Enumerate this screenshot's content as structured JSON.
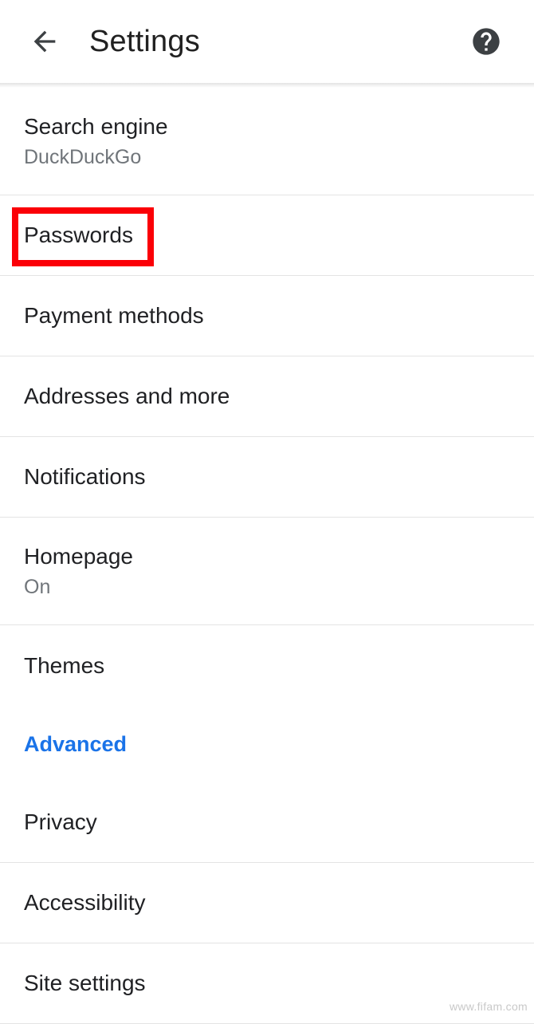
{
  "appbar": {
    "back_icon": "arrow-left-icon",
    "title": "Settings",
    "help_icon": "help-circle-icon"
  },
  "settings": {
    "rows": [
      {
        "title": "Search engine",
        "subtitle": "DuckDuckGo",
        "type": "item"
      },
      {
        "title": "Passwords",
        "subtitle": "",
        "type": "item",
        "highlighted": true
      },
      {
        "title": "Payment methods",
        "subtitle": "",
        "type": "item"
      },
      {
        "title": "Addresses and more",
        "subtitle": "",
        "type": "item"
      },
      {
        "title": "Notifications",
        "subtitle": "",
        "type": "item"
      },
      {
        "title": "Homepage",
        "subtitle": "On",
        "type": "item"
      },
      {
        "title": "Themes",
        "subtitle": "",
        "type": "item"
      },
      {
        "title": "Advanced",
        "subtitle": "",
        "type": "section"
      },
      {
        "title": "Privacy",
        "subtitle": "",
        "type": "item"
      },
      {
        "title": "Accessibility",
        "subtitle": "",
        "type": "item"
      },
      {
        "title": "Site settings",
        "subtitle": "",
        "type": "item"
      }
    ]
  },
  "colors": {
    "accent": "#1a73e8",
    "highlight": "#fb0007",
    "text_primary": "#202124",
    "text_secondary": "#70757a"
  },
  "watermark": "www.fifam.com"
}
